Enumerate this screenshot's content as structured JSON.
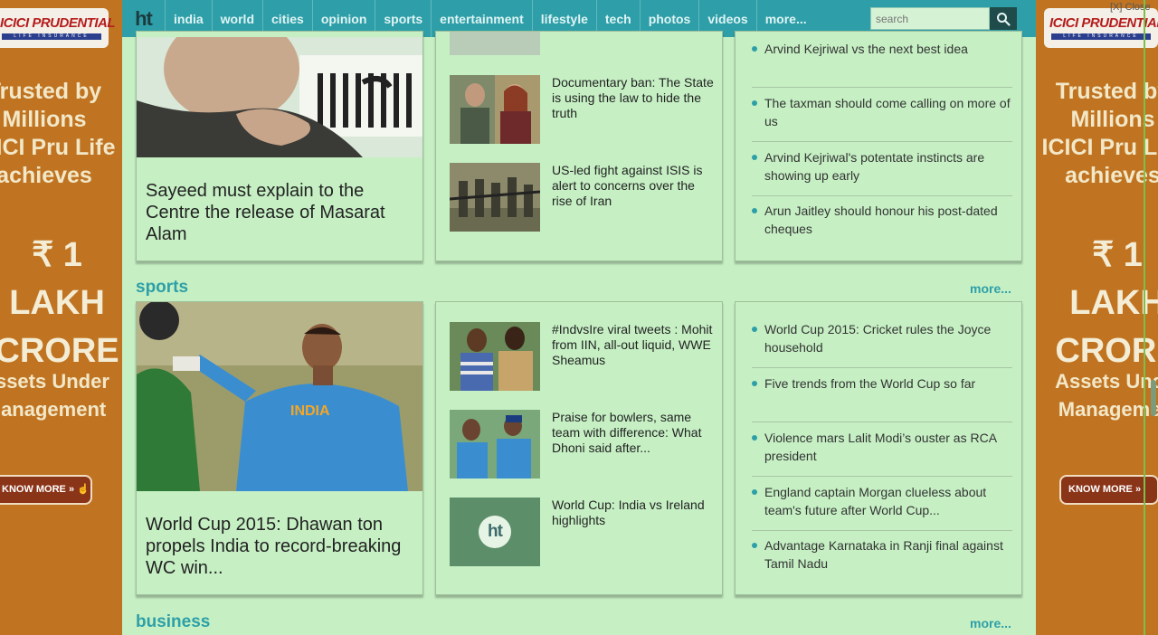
{
  "ad": {
    "logo_text": "ICICI PRUDENTIAL",
    "logo_sub": "LIFE INSURANCE",
    "tagline_lines": [
      "Trusted by",
      "Millions",
      "ICICI Pru Life",
      "achieves"
    ],
    "amount_lines": [
      "₹ 1 LAKH",
      "CRORE"
    ],
    "assets_lines": [
      "Assets Under",
      "Management"
    ],
    "know_more": "KNOW MORE",
    "close_label": "[X] Close"
  },
  "nav": {
    "brand": "ht",
    "items": [
      "india",
      "world",
      "cities",
      "opinion",
      "sports",
      "entertainment",
      "lifestyle",
      "tech",
      "photos",
      "videos",
      "more..."
    ],
    "search_placeholder": "search"
  },
  "opinion": {
    "hero_title": "Sayeed must explain to the Centre the release of Masarat Alam",
    "stories": [
      "Documentary ban: The State is using the law to hide the truth",
      "US-led fight against ISIS is alert to concerns over the rise of Iran"
    ],
    "list": [
      "Arvind Kejriwal vs the next best idea",
      "The taxman should come calling on more of us",
      "Arvind Kejriwal's potentate instincts are showing up early",
      "Arun Jaitley should honour his post-dated cheques"
    ]
  },
  "sports": {
    "title": "sports",
    "more": "more...",
    "hero_title": "World Cup 2015: Dhawan ton propels India to record-breaking WC win...",
    "hero_jersey": "INDIA",
    "stories": [
      "#IndvsIre viral tweets : Mohit from IIN, all-out liquid, WWE Sheamus",
      "Praise for bowlers, same team with difference: What Dhoni said after...",
      "World Cup: India vs Ireland highlights"
    ],
    "ht_logo": "ht",
    "list": [
      "World Cup 2015: Cricket rules the Joyce household",
      "Five trends from the World Cup so far",
      "Violence mars Lalit Modi’s ouster as RCA president",
      "England captain Morgan clueless about team's future after World Cup...",
      "Advantage Karnataka in Ranji final against Tamil Nadu"
    ]
  },
  "business": {
    "title": "business",
    "more": "more..."
  },
  "colors": {
    "nav_bg": "#2e9fa8",
    "accent": "#2e9fa8",
    "page_bg": "#c6f0c4",
    "ad_bg": "#c07422"
  }
}
